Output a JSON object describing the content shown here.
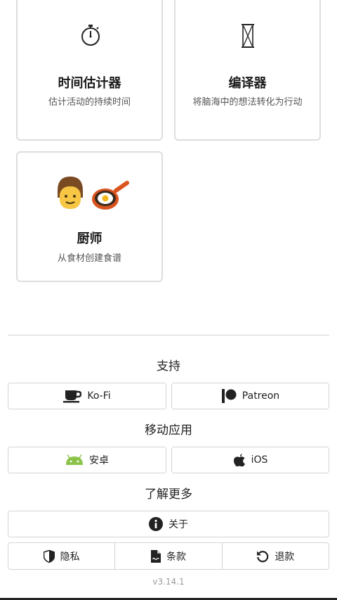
{
  "tools": [
    {
      "title": "时间估计器",
      "description": "估计活动的持续时间",
      "icon": "stopwatch-icon"
    },
    {
      "title": "编译器",
      "description": "将脑海中的想法转化为行动",
      "icon": "hourglass-icon"
    },
    {
      "title": "厨师",
      "description": "从食材创建食谱",
      "icon": "cook-and-frying-pan-icon"
    }
  ],
  "support": {
    "title": "支持",
    "kofi_label": "Ko-Fi",
    "patreon_label": "Patreon"
  },
  "mobile": {
    "title": "移动应用",
    "android_label": "安卓",
    "ios_label": "iOS"
  },
  "learn_more": {
    "title": "了解更多",
    "about_label": "关于",
    "privacy_label": "隐私",
    "terms_label": "条款",
    "refund_label": "退款"
  },
  "version": "v3.14.1",
  "colors": {
    "android_green": "#8bc34a",
    "card_border": "#dedede",
    "pan_orange": "#d9541e"
  }
}
